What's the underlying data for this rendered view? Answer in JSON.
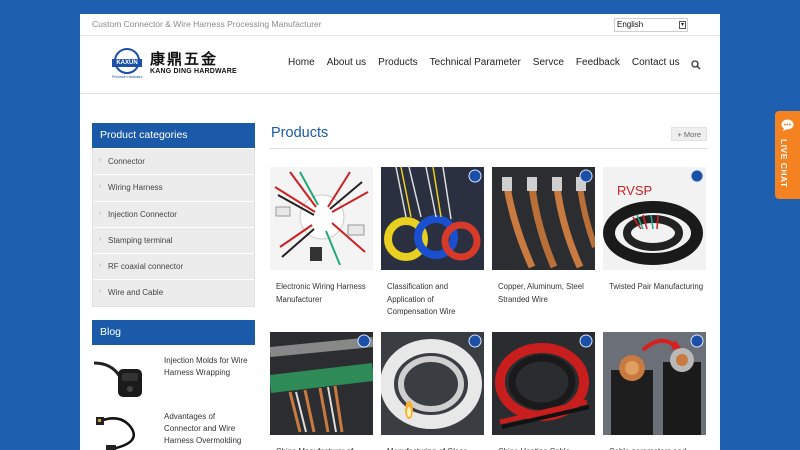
{
  "topbar": {
    "tagline": "Custom Connector & Wire Harness Processing Manufacturer",
    "language": "English"
  },
  "logo": {
    "mark_text": "KAXUN",
    "mark_sub": "Precision Hardware",
    "name_cn": "康鼎五金",
    "name_en": "KANG DING HARDWARE"
  },
  "nav": {
    "items": [
      "Home",
      "About us",
      "Products",
      "Technical Parameter",
      "Servce",
      "Feedback",
      "Contact us"
    ]
  },
  "sidebar": {
    "categories_title": "Product categories",
    "categories": [
      "Connector",
      "Wiring Harness",
      "Injection Connector",
      "Stamping terminal",
      "RF coaxial connector",
      "Wire and Cable"
    ],
    "blog_title": "Blog",
    "blog_posts": [
      "Injection Molds for Wire Harness Wrapping",
      "Advantages of Connector and Wire Harness Overmolding"
    ]
  },
  "main": {
    "title": "Products",
    "more_label": "+ More",
    "products": [
      "Electronic Wiring Harness Manufacturer",
      "Classification and Application of Compensation Wire",
      "Copper, Aluminum, Steel Stranded Wire",
      "Twisted Pair Manufacturing",
      "China Manufacturer of",
      "Manufacturing of Glass",
      "China Heating Cable",
      "Cable parameters and"
    ],
    "image_text_rvsp": "RVSP"
  },
  "live_chat": {
    "label": "LIVE CHAT"
  },
  "colors": {
    "background": "#1f5fb0",
    "accent": "#1a5aa8",
    "live_chat": "#f58220"
  }
}
